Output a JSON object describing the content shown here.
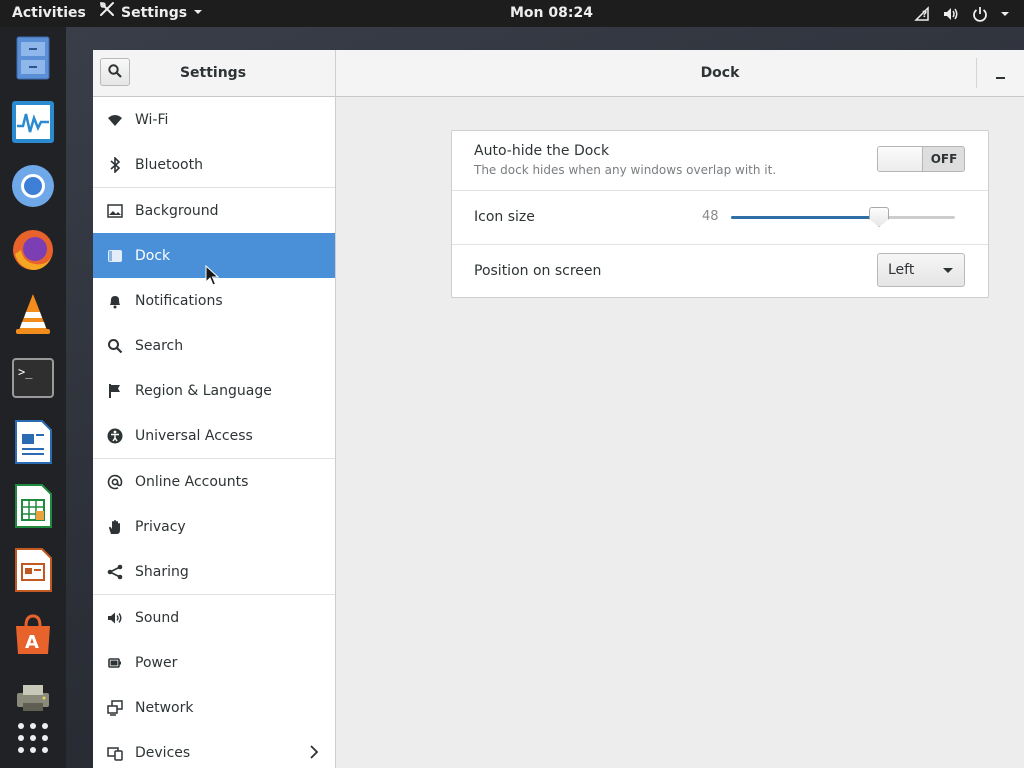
{
  "topbar": {
    "activities": "Activities",
    "app_menu": "Settings",
    "clock": "Mon 08:24"
  },
  "dock_apps": [
    {
      "name": "Files",
      "icon": "files-icon"
    },
    {
      "name": "System Monitor",
      "icon": "system-monitor-icon"
    },
    {
      "name": "Chromium",
      "icon": "chromium-icon"
    },
    {
      "name": "Firefox",
      "icon": "firefox-icon"
    },
    {
      "name": "VLC",
      "icon": "vlc-icon"
    },
    {
      "name": "Terminal",
      "icon": "terminal-icon"
    },
    {
      "name": "LibreOffice Writer",
      "icon": "writer-icon"
    },
    {
      "name": "LibreOffice Calc",
      "icon": "calc-icon"
    },
    {
      "name": "LibreOffice Impress",
      "icon": "impress-icon"
    },
    {
      "name": "Ubuntu Software",
      "icon": "software-icon"
    },
    {
      "name": "Printer",
      "icon": "printer-icon"
    },
    {
      "name": "Show Applications",
      "icon": "app-grid-icon"
    }
  ],
  "window": {
    "sidebar_title": "Settings",
    "panel_title": "Dock"
  },
  "sidebar": {
    "items": [
      {
        "label": "Wi-Fi",
        "icon": "wifi-icon"
      },
      {
        "label": "Bluetooth",
        "icon": "bluetooth-icon"
      },
      {
        "label": "Background",
        "icon": "background-icon"
      },
      {
        "label": "Dock",
        "icon": "dock-icon",
        "selected": true
      },
      {
        "label": "Notifications",
        "icon": "bell-icon"
      },
      {
        "label": "Search",
        "icon": "search-icon"
      },
      {
        "label": "Region & Language",
        "icon": "flag-icon"
      },
      {
        "label": "Universal Access",
        "icon": "accessibility-icon"
      },
      {
        "label": "Online Accounts",
        "icon": "at-icon"
      },
      {
        "label": "Privacy",
        "icon": "hand-icon"
      },
      {
        "label": "Sharing",
        "icon": "share-icon"
      },
      {
        "label": "Sound",
        "icon": "speaker-icon"
      },
      {
        "label": "Power",
        "icon": "power-plug-icon"
      },
      {
        "label": "Network",
        "icon": "network-icon"
      },
      {
        "label": "Devices",
        "icon": "devices-icon"
      }
    ]
  },
  "dock_panel": {
    "autohide": {
      "title": "Auto-hide the Dock",
      "subtitle": "The dock hides when any windows overlap with it.",
      "state_label": "OFF",
      "enabled": false
    },
    "icon_size": {
      "title": "Icon size",
      "value": "48",
      "fraction": 0.66
    },
    "position": {
      "title": "Position on screen",
      "selected": "Left"
    }
  },
  "colors": {
    "accent": "#4a90d9",
    "slider_fill": "#2f6fa8",
    "topbar": "#1d1d1d"
  }
}
